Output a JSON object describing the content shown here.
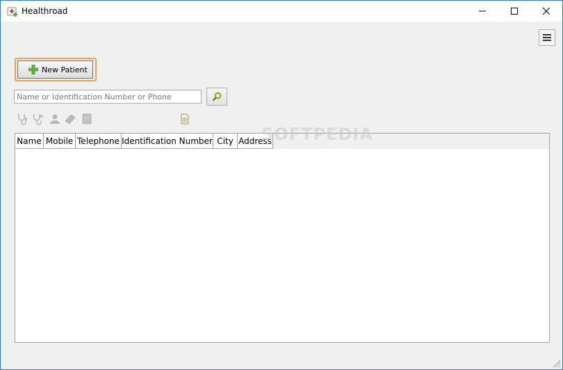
{
  "window": {
    "title": "Healthroad"
  },
  "toolbar": {
    "new_patient_label": "New Patient"
  },
  "search": {
    "placeholder": "Name or Identification Number or Phone",
    "value": ""
  },
  "grid": {
    "columns": [
      "Name",
      "Mobile",
      "Telephone",
      "Identification Number",
      "City",
      "Address"
    ],
    "rows": []
  },
  "watermark": "SOFTPEDIA",
  "colors": {
    "focus_border": "#f7a04a",
    "plus_green": "#5fb336",
    "window_border": "#2b79d3"
  }
}
